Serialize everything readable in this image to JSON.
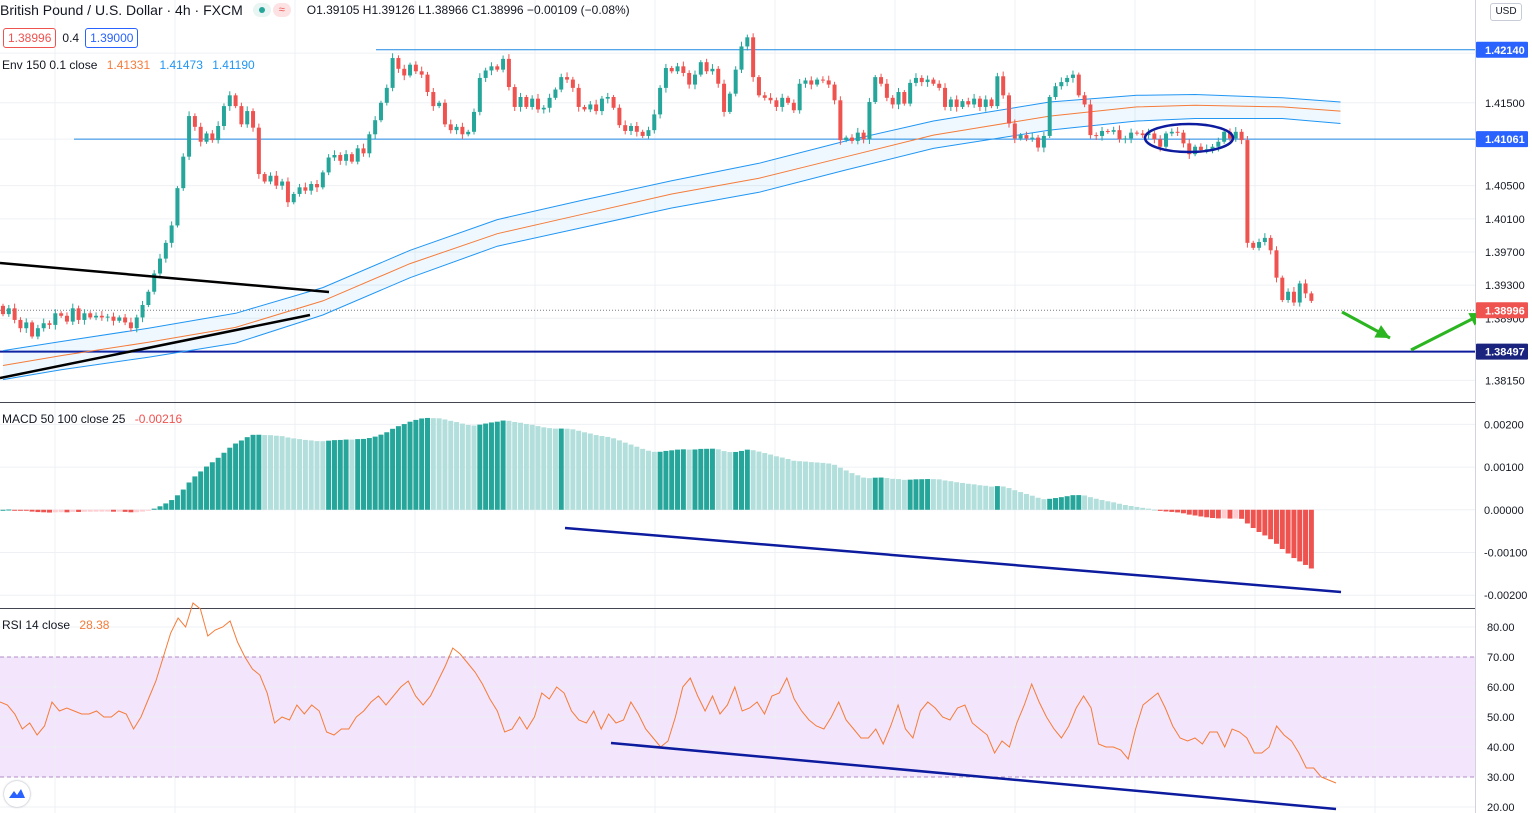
{
  "header": {
    "symbol": "British Pound / U.S. Dollar · 4h · FXCM",
    "ohlc": "O1.39105  H1.39126  L1.38966  C1.38996  −0.00109 (−0.08%)",
    "sell_price": "1.38996",
    "spread": "0.4",
    "buy_price": "1.39000",
    "currency": "USD",
    "wave_icon": "≈"
  },
  "indicators": {
    "env_label": "Env 150 0.1 close",
    "env_basis": "1.41331",
    "env_upper": "1.41473",
    "env_lower": "1.41190",
    "macd_label": "MACD 50 100 close 25",
    "macd_value": "-0.00216",
    "rsi_label": "RSI 14 close",
    "rsi_value": "28.38"
  },
  "colors": {
    "up": "#26a69a",
    "down": "#ef5350",
    "env_basis": "#f57c3a",
    "env_band": "#2196f3",
    "rsi_line": "#f57c3a",
    "rsi_band": "#f3e5fb",
    "hist_up_strong": "#26a69a",
    "hist_up_weak": "#b2dfdb",
    "hist_down_strong": "#ef5350",
    "hist_down_weak": "#ffcdd2",
    "trend_navy": "#0d1b9e",
    "arrow_green": "#2bb520"
  },
  "chart_data": {
    "type": "candlestick",
    "price_axis": {
      "ticks": [
        "1.42100",
        "1.41500",
        "1.41061",
        "1.40500",
        "1.40100",
        "1.39700",
        "1.39300",
        "1.38900",
        "1.38497",
        "1.38150"
      ],
      "ylim": [
        1.3795,
        1.4268
      ],
      "labels": [
        {
          "value": 1.4214,
          "text": "1.42140",
          "color": "#2962ff"
        },
        {
          "value": 1.41061,
          "text": "1.41061",
          "color": "#2962ff"
        },
        {
          "value": 1.38996,
          "text": "1.38996",
          "color": "#ef5350"
        },
        {
          "value": 1.38497,
          "text": "1.38497",
          "color": "#1a237e"
        }
      ]
    },
    "candles": [
      [
        1.3905,
        1.3895
      ],
      [
        1.3895,
        1.3902
      ],
      [
        1.3902,
        1.3888
      ],
      [
        1.3888,
        1.3878
      ],
      [
        1.3878,
        1.3885
      ],
      [
        1.3885,
        1.3868
      ],
      [
        1.3868,
        1.3878
      ],
      [
        1.3878,
        1.3884
      ],
      [
        1.3884,
        1.3882
      ],
      [
        1.3882,
        1.3896
      ],
      [
        1.3896,
        1.3893
      ],
      [
        1.3893,
        1.3886
      ],
      [
        1.3886,
        1.3902
      ],
      [
        1.3902,
        1.3888
      ],
      [
        1.3888,
        1.3896
      ],
      [
        1.3896,
        1.3891
      ],
      [
        1.3891,
        1.3893
      ],
      [
        1.3893,
        1.3891
      ],
      [
        1.3891,
        1.3892
      ],
      [
        1.3892,
        1.3887
      ],
      [
        1.3887,
        1.3891
      ],
      [
        1.3891,
        1.3885
      ],
      [
        1.3885,
        1.3878
      ],
      [
        1.3878,
        1.3891
      ],
      [
        1.3891,
        1.3906
      ],
      [
        1.3906,
        1.3922
      ],
      [
        1.3922,
        1.3944
      ],
      [
        1.3944,
        1.3962
      ],
      [
        1.3962,
        1.3981
      ],
      [
        1.3981,
        1.4002
      ],
      [
        1.4002,
        1.4047
      ],
      [
        1.4047,
        1.4085
      ],
      [
        1.4085,
        1.4134
      ],
      [
        1.4134,
        1.4121
      ],
      [
        1.4121,
        1.4103
      ],
      [
        1.4103,
        1.4113
      ],
      [
        1.4113,
        1.4105
      ],
      [
        1.4105,
        1.4122
      ],
      [
        1.4122,
        1.4146
      ],
      [
        1.4146,
        1.4159
      ],
      [
        1.4159,
        1.4146
      ],
      [
        1.4146,
        1.4124
      ],
      [
        1.4124,
        1.414
      ],
      [
        1.414,
        1.412
      ],
      [
        1.412,
        1.4064
      ],
      [
        1.4064,
        1.4055
      ],
      [
        1.4055,
        1.4062
      ],
      [
        1.4062,
        1.405
      ],
      [
        1.405,
        1.4055
      ],
      [
        1.4055,
        1.403
      ],
      [
        1.403,
        1.404
      ],
      [
        1.404,
        1.4048
      ],
      [
        1.4048,
        1.4044
      ],
      [
        1.4044,
        1.4052
      ],
      [
        1.4052,
        1.4048
      ],
      [
        1.4048,
        1.4066
      ],
      [
        1.4066,
        1.4084
      ],
      [
        1.4084,
        1.4087
      ],
      [
        1.4087,
        1.408
      ],
      [
        1.408,
        1.4088
      ],
      [
        1.4088,
        1.4079
      ],
      [
        1.4079,
        1.4095
      ],
      [
        1.4095,
        1.4089
      ],
      [
        1.4089,
        1.4112
      ],
      [
        1.4112,
        1.4129
      ],
      [
        1.4129,
        1.415
      ],
      [
        1.415,
        1.4168
      ],
      [
        1.4168,
        1.4204
      ],
      [
        1.4204,
        1.4191
      ],
      [
        1.4191,
        1.4183
      ],
      [
        1.4183,
        1.4196
      ],
      [
        1.4196,
        1.4188
      ],
      [
        1.4188,
        1.4184
      ],
      [
        1.4184,
        1.4163
      ],
      [
        1.4163,
        1.4146
      ],
      [
        1.4146,
        1.415
      ],
      [
        1.415,
        1.4124
      ],
      [
        1.4124,
        1.4117
      ],
      [
        1.4117,
        1.4121
      ],
      [
        1.4121,
        1.4112
      ],
      [
        1.4112,
        1.4115
      ],
      [
        1.4115,
        1.4139
      ],
      [
        1.4139,
        1.418
      ],
      [
        1.418,
        1.4189
      ],
      [
        1.4189,
        1.4194
      ],
      [
        1.4194,
        1.419
      ],
      [
        1.419,
        1.4203
      ],
      [
        1.4203,
        1.4169
      ],
      [
        1.4169,
        1.4145
      ],
      [
        1.4145,
        1.4157
      ],
      [
        1.4157,
        1.4145
      ],
      [
        1.4145,
        1.4155
      ],
      [
        1.4155,
        1.4142
      ],
      [
        1.4142,
        1.4144
      ],
      [
        1.4144,
        1.4156
      ],
      [
        1.4156,
        1.4166
      ],
      [
        1.4166,
        1.4181
      ],
      [
        1.4181,
        1.4178
      ],
      [
        1.4178,
        1.4168
      ],
      [
        1.4168,
        1.4145
      ],
      [
        1.4145,
        1.4142
      ],
      [
        1.4142,
        1.4148
      ],
      [
        1.4148,
        1.414
      ],
      [
        1.414,
        1.4155
      ],
      [
        1.4155,
        1.4157
      ],
      [
        1.4157,
        1.4144
      ],
      [
        1.4144,
        1.4123
      ],
      [
        1.4123,
        1.4116
      ],
      [
        1.4116,
        1.4122
      ],
      [
        1.4122,
        1.4115
      ],
      [
        1.4115,
        1.411
      ],
      [
        1.411,
        1.4117
      ],
      [
        1.4117,
        1.4136
      ],
      [
        1.4136,
        1.4168
      ],
      [
        1.4168,
        1.4192
      ],
      [
        1.4192,
        1.4188
      ],
      [
        1.4188,
        1.4194
      ],
      [
        1.4194,
        1.4186
      ],
      [
        1.4186,
        1.4172
      ],
      [
        1.4172,
        1.4184
      ],
      [
        1.4184,
        1.4199
      ],
      [
        1.4199,
        1.4188
      ],
      [
        1.4188,
        1.4191
      ],
      [
        1.4191,
        1.4173
      ],
      [
        1.4173,
        1.4139
      ],
      [
        1.4139,
        1.4161
      ],
      [
        1.4161,
        1.419
      ],
      [
        1.419,
        1.4218
      ],
      [
        1.4218,
        1.4229
      ],
      [
        1.4229,
        1.4181
      ],
      [
        1.4181,
        1.4159
      ],
      [
        1.4159,
        1.4156
      ],
      [
        1.4156,
        1.4153
      ],
      [
        1.4153,
        1.4145
      ],
      [
        1.4145,
        1.4156
      ],
      [
        1.4156,
        1.415
      ],
      [
        1.415,
        1.4141
      ],
      [
        1.4141,
        1.4173
      ],
      [
        1.4173,
        1.4177
      ],
      [
        1.4177,
        1.4172
      ],
      [
        1.4172,
        1.4178
      ],
      [
        1.4178,
        1.4177
      ],
      [
        1.4177,
        1.4172
      ],
      [
        1.4172,
        1.4153
      ],
      [
        1.4153,
        1.4105
      ],
      [
        1.4105,
        1.4108
      ],
      [
        1.4108,
        1.4104
      ],
      [
        1.4104,
        1.4114
      ],
      [
        1.4114,
        1.4106
      ],
      [
        1.4106,
        1.4151
      ],
      [
        1.4151,
        1.4181
      ],
      [
        1.4181,
        1.4173
      ],
      [
        1.4173,
        1.4156
      ],
      [
        1.4156,
        1.4148
      ],
      [
        1.4148,
        1.4163
      ],
      [
        1.4163,
        1.4149
      ],
      [
        1.4149,
        1.4174
      ],
      [
        1.4174,
        1.418
      ],
      [
        1.418,
        1.4175
      ],
      [
        1.4175,
        1.4178
      ],
      [
        1.4178,
        1.4173
      ],
      [
        1.4173,
        1.4168
      ],
      [
        1.4168,
        1.4145
      ],
      [
        1.4145,
        1.4154
      ],
      [
        1.4154,
        1.4145
      ],
      [
        1.4145,
        1.4152
      ],
      [
        1.4152,
        1.4148
      ],
      [
        1.4148,
        1.4155
      ],
      [
        1.4155,
        1.4145
      ],
      [
        1.4145,
        1.4154
      ],
      [
        1.4154,
        1.4146
      ],
      [
        1.4146,
        1.4182
      ],
      [
        1.4182,
        1.4159
      ],
      [
        1.4159,
        1.4125
      ],
      [
        1.4125,
        1.4107
      ],
      [
        1.4107,
        1.4111
      ],
      [
        1.4111,
        1.4107
      ],
      [
        1.4107,
        1.4108
      ],
      [
        1.4108,
        1.4096
      ],
      [
        1.4096,
        1.411
      ],
      [
        1.411,
        1.4157
      ],
      [
        1.4157,
        1.417
      ],
      [
        1.417,
        1.4175
      ],
      [
        1.4175,
        1.418
      ],
      [
        1.418,
        1.4184
      ],
      [
        1.4184,
        1.4159
      ],
      [
        1.4159,
        1.4148
      ],
      [
        1.4148,
        1.4111
      ],
      [
        1.4111,
        1.411
      ],
      [
        1.411,
        1.4116
      ],
      [
        1.4116,
        1.4115
      ],
      [
        1.4115,
        1.4117
      ],
      [
        1.4117,
        1.4106
      ],
      [
        1.4106,
        1.4107
      ],
      [
        1.4107,
        1.4114
      ],
      [
        1.4114,
        1.4113
      ],
      [
        1.4113,
        1.4111
      ],
      [
        1.4111,
        1.4113
      ],
      [
        1.4113,
        1.4106
      ],
      [
        1.4106,
        1.4097
      ],
      [
        1.4097,
        1.4113
      ],
      [
        1.4113,
        1.4115
      ],
      [
        1.4115,
        1.4114
      ],
      [
        1.4114,
        1.4101
      ],
      [
        1.4101,
        1.4088
      ],
      [
        1.4088,
        1.4097
      ],
      [
        1.4097,
        1.4093
      ],
      [
        1.4093,
        1.4094
      ],
      [
        1.4094,
        1.4097
      ],
      [
        1.4097,
        1.4103
      ],
      [
        1.4103,
        1.4115
      ],
      [
        1.4115,
        1.4107
      ],
      [
        1.4107,
        1.4115
      ],
      [
        1.4115,
        1.4105
      ],
      [
        1.4105,
        1.3981
      ],
      [
        1.3981,
        1.3975
      ],
      [
        1.3975,
        1.3982
      ],
      [
        1.3982,
        1.3987
      ],
      [
        1.3987,
        1.3972
      ],
      [
        1.3972,
        1.3939
      ],
      [
        1.3939,
        1.3912
      ],
      [
        1.3912,
        1.3922
      ],
      [
        1.3922,
        1.3909
      ],
      [
        1.3909,
        1.3932
      ],
      [
        1.3932,
        1.392
      ],
      [
        1.392,
        1.3911
      ]
    ],
    "envelope": {
      "basis": [
        [
          0,
          1.3833
        ],
        [
          10,
          1.3845
        ],
        [
          25,
          1.3861
        ],
        [
          40,
          1.3879
        ],
        [
          55,
          1.3911
        ],
        [
          70,
          1.3956
        ],
        [
          85,
          1.3992
        ],
        [
          100,
          1.4016
        ],
        [
          115,
          1.404
        ],
        [
          130,
          1.4059
        ],
        [
          145,
          1.4085
        ],
        [
          160,
          1.4111
        ],
        [
          180,
          1.4134
        ],
        [
          195,
          1.4145
        ],
        [
          205,
          1.4147
        ],
        [
          220,
          1.4145
        ],
        [
          230,
          1.414
        ]
      ],
      "upper": [
        [
          0,
          1.3851
        ],
        [
          10,
          1.3862
        ],
        [
          25,
          1.3878
        ],
        [
          40,
          1.3896
        ],
        [
          55,
          1.3927
        ],
        [
          70,
          1.3972
        ],
        [
          85,
          1.4009
        ],
        [
          100,
          1.4033
        ],
        [
          115,
          1.4056
        ],
        [
          130,
          1.4077
        ],
        [
          145,
          1.4104
        ],
        [
          160,
          1.4128
        ],
        [
          180,
          1.4151
        ],
        [
          195,
          1.4159
        ],
        [
          205,
          1.416
        ],
        [
          220,
          1.4156
        ],
        [
          230,
          1.4151
        ]
      ],
      "lower": [
        [
          0,
          1.3816
        ],
        [
          10,
          1.3828
        ],
        [
          25,
          1.3843
        ],
        [
          40,
          1.386
        ],
        [
          55,
          1.3894
        ],
        [
          70,
          1.3939
        ],
        [
          85,
          1.3977
        ],
        [
          100,
          1.4
        ],
        [
          115,
          1.4023
        ],
        [
          130,
          1.4042
        ],
        [
          145,
          1.4069
        ],
        [
          160,
          1.4095
        ],
        [
          180,
          1.4117
        ],
        [
          195,
          1.4128
        ],
        [
          205,
          1.4131
        ],
        [
          220,
          1.4131
        ],
        [
          230,
          1.4125
        ]
      ]
    },
    "hlines": [
      1.4214,
      1.41061,
      1.38497
    ],
    "macd": {
      "ticks": [
        "0.00200",
        "0.00100",
        "0.00000",
        "-0.00100",
        "-0.00200"
      ],
      "ylim": [
        -0.0023,
        0.0025
      ]
    },
    "rsi": {
      "ticks": [
        "80.00",
        "70.00",
        "60.00",
        "50.00",
        "40.00",
        "30.00",
        "20.00"
      ],
      "ylim": [
        18,
        86
      ],
      "band": [
        30,
        70
      ],
      "values": [
        55,
        54,
        51,
        46,
        48,
        44,
        47,
        55,
        52,
        53,
        52,
        51,
        51,
        52,
        50,
        50,
        52,
        51,
        46,
        50,
        56,
        62,
        70,
        78,
        83,
        80,
        88,
        86,
        77,
        79,
        80,
        82,
        75,
        70,
        66,
        64,
        58,
        48,
        50,
        49,
        54,
        51,
        54,
        52,
        45,
        44,
        46,
        46,
        50,
        52,
        55,
        57,
        54,
        57,
        60,
        62,
        57,
        54,
        57,
        62,
        67,
        73,
        71,
        68,
        65,
        61,
        56,
        52,
        45,
        46,
        50,
        46,
        50,
        58,
        56,
        60,
        58,
        52,
        49,
        48,
        52,
        46,
        51,
        48,
        49,
        55,
        51,
        46,
        43,
        40,
        42,
        50,
        60,
        63,
        57,
        52,
        57,
        51,
        54,
        60,
        52,
        53,
        55,
        51,
        57,
        58,
        63,
        56,
        52,
        49,
        47,
        46,
        50,
        55,
        49,
        46,
        43,
        43,
        46,
        41,
        47,
        54,
        46,
        43,
        52,
        55,
        53,
        50,
        49,
        53,
        54,
        48,
        46,
        44,
        38,
        42,
        40,
        48,
        54,
        61,
        55,
        50,
        46,
        43,
        47,
        53,
        57,
        53,
        41,
        40,
        40,
        39,
        36,
        46,
        54,
        56,
        58,
        53,
        47,
        43,
        42,
        43,
        41,
        45,
        45,
        40,
        46,
        45,
        43,
        38,
        38,
        40,
        47,
        44,
        42,
        38,
        33,
        33,
        30,
        29,
        28
      ]
    },
    "annotations": {
      "macd_divergence_line": [
        [
          565,
          528
        ],
        [
          1341,
          592
        ]
      ],
      "rsi_divergence_line": [
        [
          611,
          743
        ],
        [
          1336,
          809
        ]
      ],
      "triangle_upper": [
        [
          0,
          263
        ],
        [
          329,
          292
        ]
      ],
      "triangle_lower": [
        [
          0,
          378
        ],
        [
          310,
          315
        ]
      ],
      "ellipse": {
        "cx": 1189,
        "cy": 138,
        "rx": 44,
        "ry": 14
      },
      "arrow_down": [
        [
          1342,
          312
        ],
        [
          1390,
          338
        ]
      ],
      "arrow_up": [
        [
          1411,
          350
        ],
        [
          1484,
          313
        ]
      ]
    }
  }
}
